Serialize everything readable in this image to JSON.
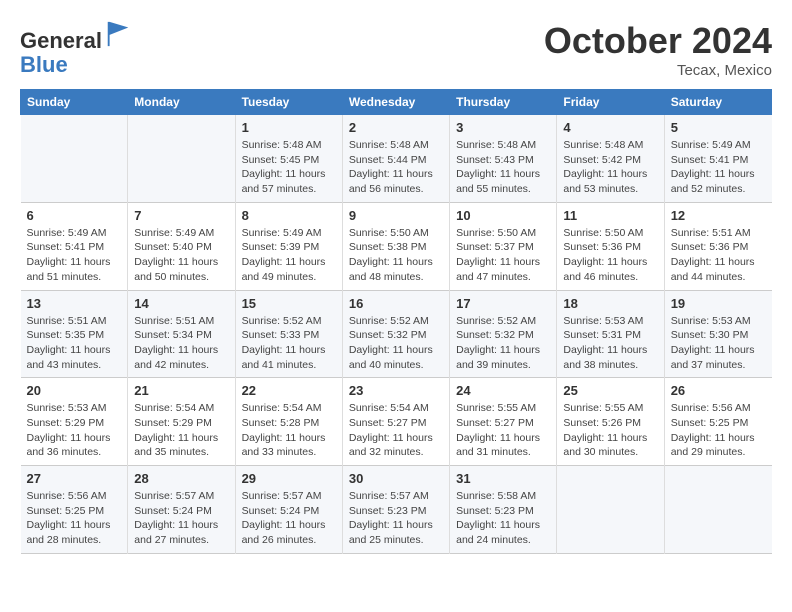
{
  "header": {
    "logo_line1": "General",
    "logo_line2": "Blue",
    "month": "October 2024",
    "location": "Tecax, Mexico"
  },
  "days_of_week": [
    "Sunday",
    "Monday",
    "Tuesday",
    "Wednesday",
    "Thursday",
    "Friday",
    "Saturday"
  ],
  "weeks": [
    [
      {
        "day": "",
        "content": ""
      },
      {
        "day": "",
        "content": ""
      },
      {
        "day": "1",
        "content": "Sunrise: 5:48 AM\nSunset: 5:45 PM\nDaylight: 11 hours and 57 minutes."
      },
      {
        "day": "2",
        "content": "Sunrise: 5:48 AM\nSunset: 5:44 PM\nDaylight: 11 hours and 56 minutes."
      },
      {
        "day": "3",
        "content": "Sunrise: 5:48 AM\nSunset: 5:43 PM\nDaylight: 11 hours and 55 minutes."
      },
      {
        "day": "4",
        "content": "Sunrise: 5:48 AM\nSunset: 5:42 PM\nDaylight: 11 hours and 53 minutes."
      },
      {
        "day": "5",
        "content": "Sunrise: 5:49 AM\nSunset: 5:41 PM\nDaylight: 11 hours and 52 minutes."
      }
    ],
    [
      {
        "day": "6",
        "content": "Sunrise: 5:49 AM\nSunset: 5:41 PM\nDaylight: 11 hours and 51 minutes."
      },
      {
        "day": "7",
        "content": "Sunrise: 5:49 AM\nSunset: 5:40 PM\nDaylight: 11 hours and 50 minutes."
      },
      {
        "day": "8",
        "content": "Sunrise: 5:49 AM\nSunset: 5:39 PM\nDaylight: 11 hours and 49 minutes."
      },
      {
        "day": "9",
        "content": "Sunrise: 5:50 AM\nSunset: 5:38 PM\nDaylight: 11 hours and 48 minutes."
      },
      {
        "day": "10",
        "content": "Sunrise: 5:50 AM\nSunset: 5:37 PM\nDaylight: 11 hours and 47 minutes."
      },
      {
        "day": "11",
        "content": "Sunrise: 5:50 AM\nSunset: 5:36 PM\nDaylight: 11 hours and 46 minutes."
      },
      {
        "day": "12",
        "content": "Sunrise: 5:51 AM\nSunset: 5:36 PM\nDaylight: 11 hours and 44 minutes."
      }
    ],
    [
      {
        "day": "13",
        "content": "Sunrise: 5:51 AM\nSunset: 5:35 PM\nDaylight: 11 hours and 43 minutes."
      },
      {
        "day": "14",
        "content": "Sunrise: 5:51 AM\nSunset: 5:34 PM\nDaylight: 11 hours and 42 minutes."
      },
      {
        "day": "15",
        "content": "Sunrise: 5:52 AM\nSunset: 5:33 PM\nDaylight: 11 hours and 41 minutes."
      },
      {
        "day": "16",
        "content": "Sunrise: 5:52 AM\nSunset: 5:32 PM\nDaylight: 11 hours and 40 minutes."
      },
      {
        "day": "17",
        "content": "Sunrise: 5:52 AM\nSunset: 5:32 PM\nDaylight: 11 hours and 39 minutes."
      },
      {
        "day": "18",
        "content": "Sunrise: 5:53 AM\nSunset: 5:31 PM\nDaylight: 11 hours and 38 minutes."
      },
      {
        "day": "19",
        "content": "Sunrise: 5:53 AM\nSunset: 5:30 PM\nDaylight: 11 hours and 37 minutes."
      }
    ],
    [
      {
        "day": "20",
        "content": "Sunrise: 5:53 AM\nSunset: 5:29 PM\nDaylight: 11 hours and 36 minutes."
      },
      {
        "day": "21",
        "content": "Sunrise: 5:54 AM\nSunset: 5:29 PM\nDaylight: 11 hours and 35 minutes."
      },
      {
        "day": "22",
        "content": "Sunrise: 5:54 AM\nSunset: 5:28 PM\nDaylight: 11 hours and 33 minutes."
      },
      {
        "day": "23",
        "content": "Sunrise: 5:54 AM\nSunset: 5:27 PM\nDaylight: 11 hours and 32 minutes."
      },
      {
        "day": "24",
        "content": "Sunrise: 5:55 AM\nSunset: 5:27 PM\nDaylight: 11 hours and 31 minutes."
      },
      {
        "day": "25",
        "content": "Sunrise: 5:55 AM\nSunset: 5:26 PM\nDaylight: 11 hours and 30 minutes."
      },
      {
        "day": "26",
        "content": "Sunrise: 5:56 AM\nSunset: 5:25 PM\nDaylight: 11 hours and 29 minutes."
      }
    ],
    [
      {
        "day": "27",
        "content": "Sunrise: 5:56 AM\nSunset: 5:25 PM\nDaylight: 11 hours and 28 minutes."
      },
      {
        "day": "28",
        "content": "Sunrise: 5:57 AM\nSunset: 5:24 PM\nDaylight: 11 hours and 27 minutes."
      },
      {
        "day": "29",
        "content": "Sunrise: 5:57 AM\nSunset: 5:24 PM\nDaylight: 11 hours and 26 minutes."
      },
      {
        "day": "30",
        "content": "Sunrise: 5:57 AM\nSunset: 5:23 PM\nDaylight: 11 hours and 25 minutes."
      },
      {
        "day": "31",
        "content": "Sunrise: 5:58 AM\nSunset: 5:23 PM\nDaylight: 11 hours and 24 minutes."
      },
      {
        "day": "",
        "content": ""
      },
      {
        "day": "",
        "content": ""
      }
    ]
  ]
}
